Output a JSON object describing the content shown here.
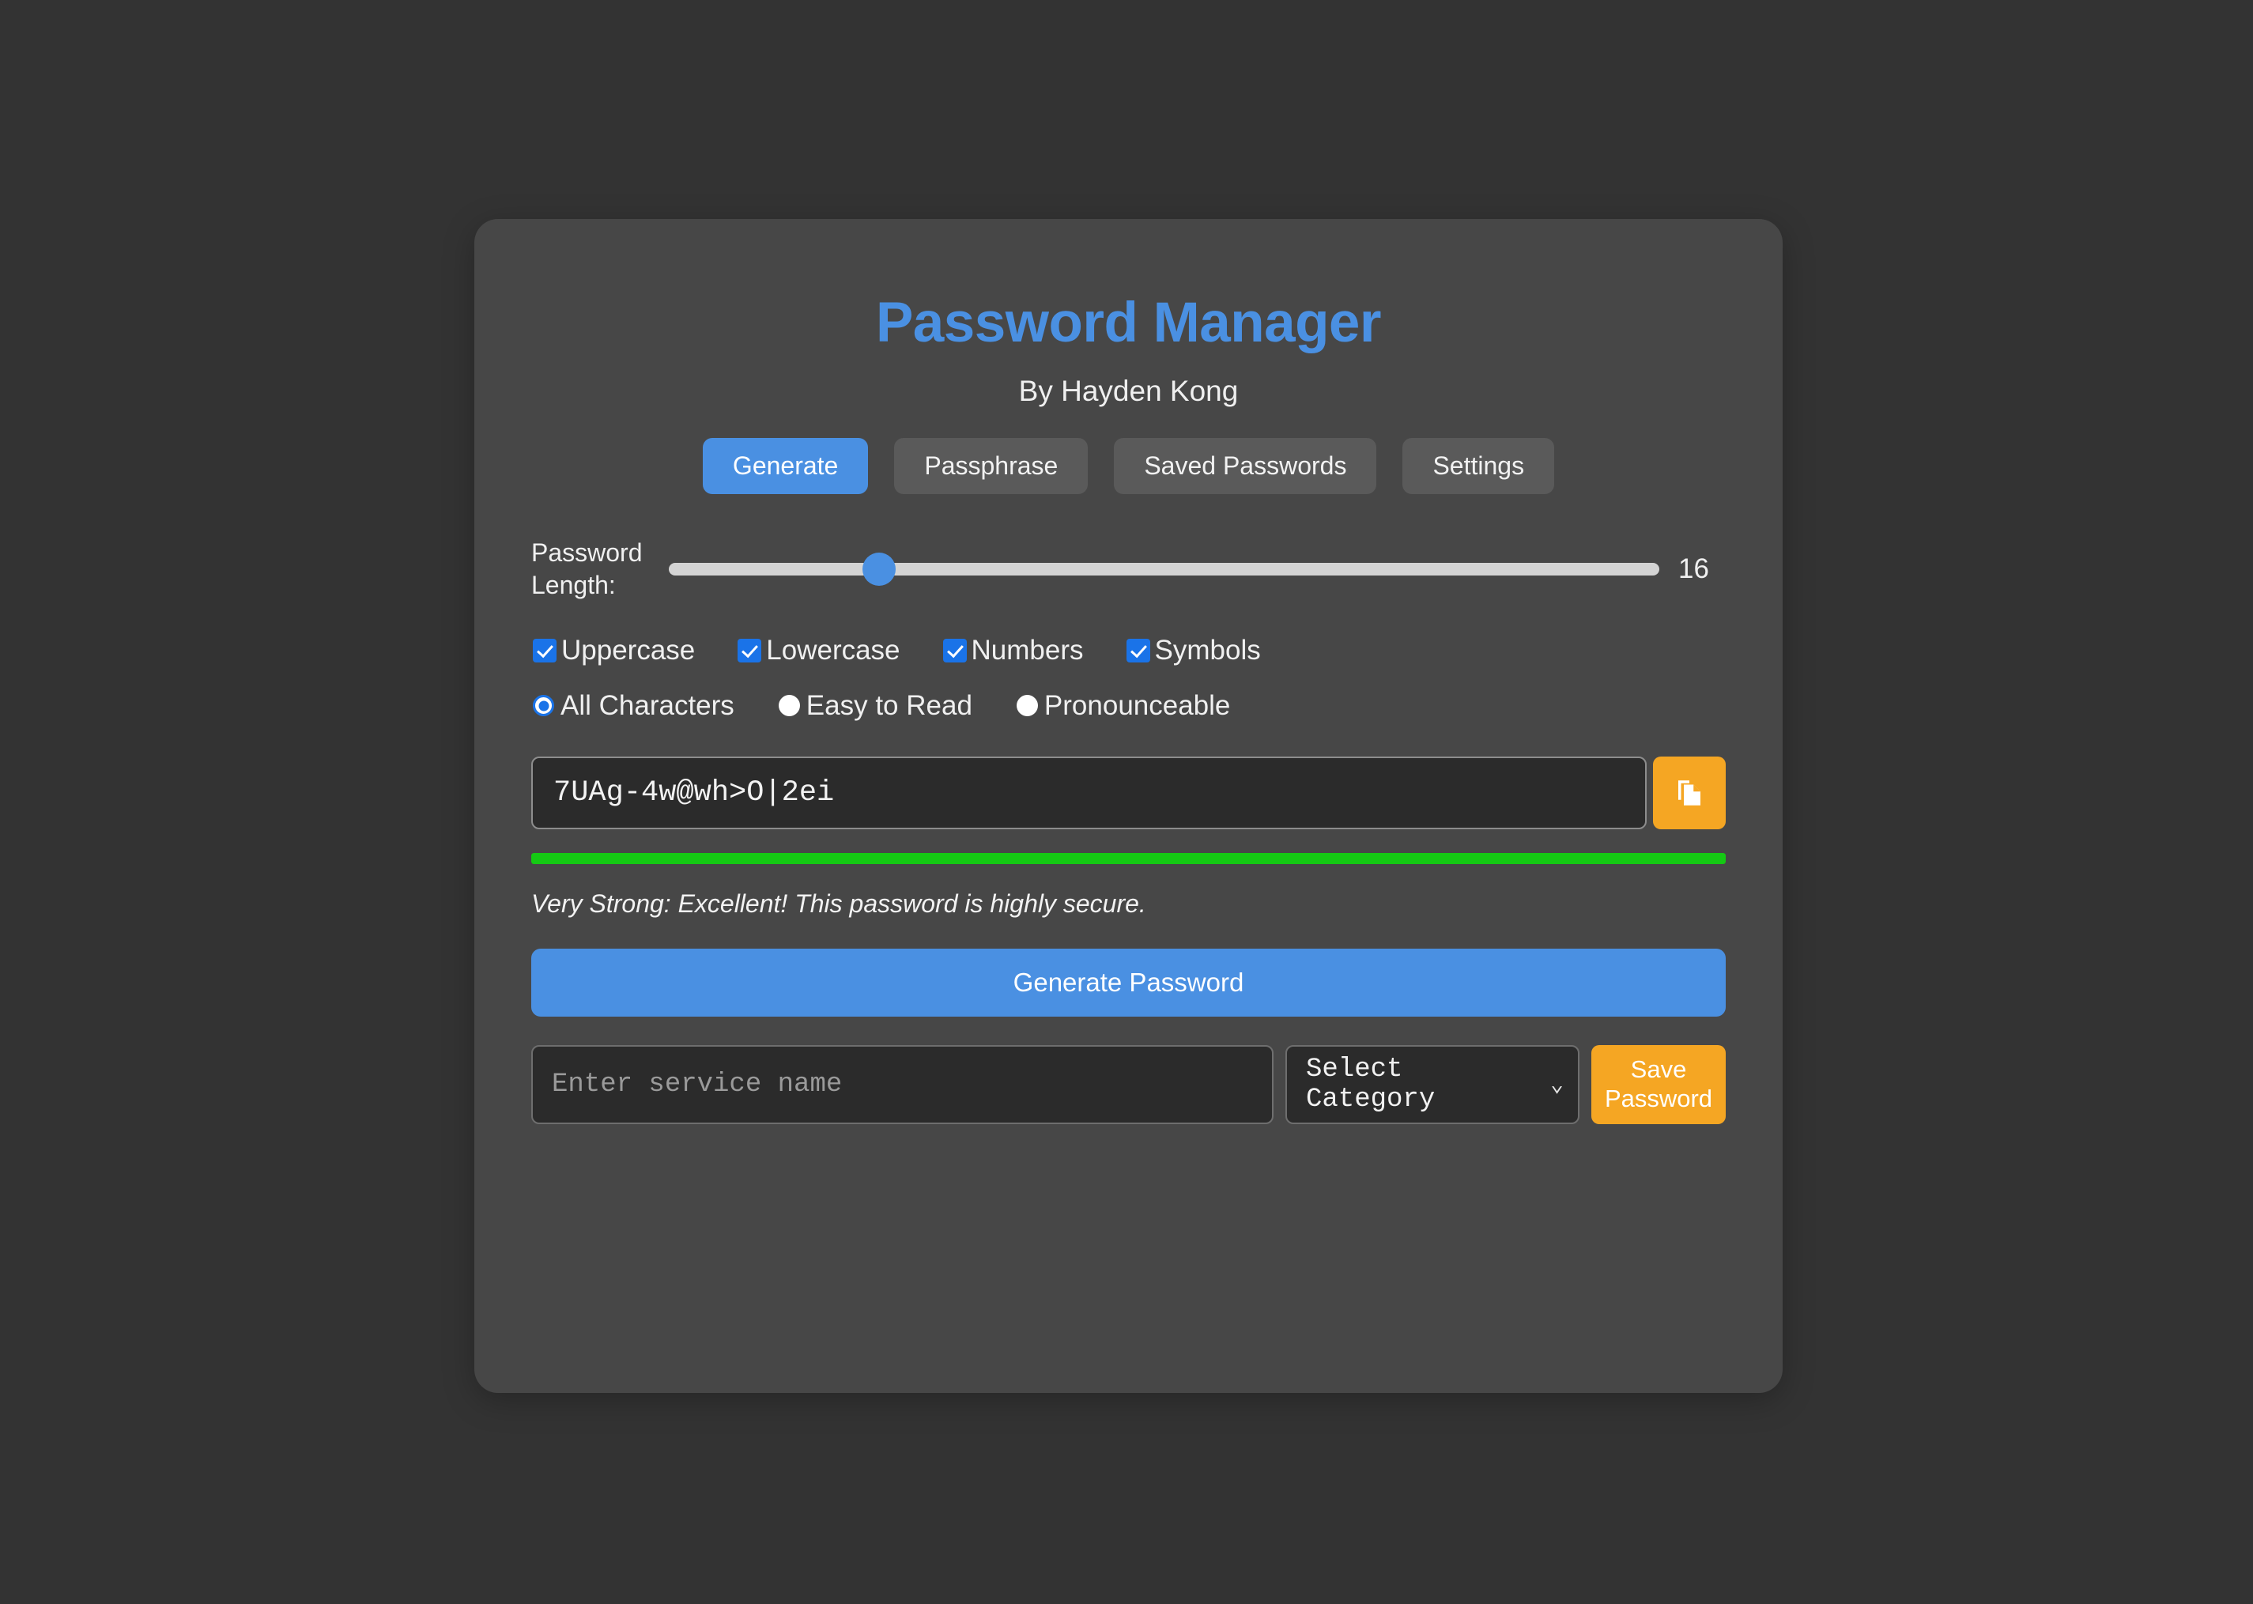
{
  "app": {
    "title": "Password Manager",
    "subtitle": "By Hayden Kong"
  },
  "tabs": [
    {
      "label": "Generate",
      "active": true
    },
    {
      "label": "Passphrase",
      "active": false
    },
    {
      "label": "Saved Passwords",
      "active": false
    },
    {
      "label": "Settings",
      "active": false
    }
  ],
  "length": {
    "label": "Password Length:",
    "value": "16",
    "percent": 21.2
  },
  "char_options": [
    {
      "label": "Uppercase",
      "checked": true
    },
    {
      "label": "Lowercase",
      "checked": true
    },
    {
      "label": "Numbers",
      "checked": true
    },
    {
      "label": "Symbols",
      "checked": true
    }
  ],
  "mode_options": [
    {
      "label": "All Characters",
      "selected": true
    },
    {
      "label": "Easy to Read",
      "selected": false
    },
    {
      "label": "Pronounceable",
      "selected": false
    }
  ],
  "password": {
    "value": "7UAg-4w@wh>O|2ei",
    "copy_icon": "copy-icon"
  },
  "strength": {
    "percent": 100,
    "text": "Very Strong: Excellent! This password is highly secure.",
    "color": "#15c914"
  },
  "actions": {
    "generate_label": "Generate Password",
    "save_label": "Save Password"
  },
  "save_form": {
    "service_placeholder": "Enter service name",
    "service_value": "",
    "category_selected": "Select Category",
    "chevron": "⌄"
  },
  "colors": {
    "page_background": "#333333",
    "card_background": "#474747",
    "accent_blue": "#4a90e2",
    "accent_orange": "#f5a623",
    "strength_green": "#15c914",
    "checkbox_blue": "#1a73e8"
  }
}
